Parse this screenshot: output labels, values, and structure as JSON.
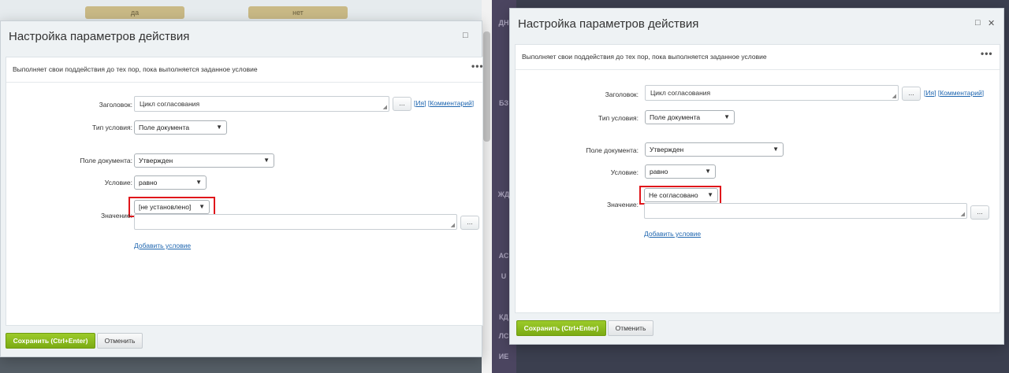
{
  "background": {
    "left_stage_buttons": [
      "да",
      "нет"
    ]
  },
  "sidebar": {
    "items": [
      "ДН",
      "БЗ",
      "ЖД",
      "АС",
      "U",
      "КД",
      "ЛС",
      "ИЕ"
    ]
  },
  "dialogs": [
    {
      "title": "Настройка параметров действия",
      "description": "Выполняет свои поддействия до тех пор, пока выполняется заданное условие",
      "more": "•••",
      "labels": {
        "title_field": "Заголовок:",
        "condition_type": "Тип условия:",
        "document_field": "Поле документа:",
        "condition": "Условие:",
        "value": "Значение:"
      },
      "title_value": "Цикл согласования",
      "dots": "...",
      "link_name": "Ия",
      "link_comment": "Комментарий",
      "condition_type_value": "Поле документа",
      "document_field_value": "Утвержден",
      "condition_value": "равно",
      "value_select": "[не установлено]",
      "value_text": "",
      "add_condition": "Добавить условие",
      "save_label": "Сохранить (Ctrl+Enter)",
      "cancel_label": "Отменить",
      "maximize_icon": "□",
      "close_icon": ""
    },
    {
      "title": "Настройка параметров действия",
      "description": "Выполняет свои поддействия до тех пор, пока выполняется заданное условие",
      "more": "•••",
      "labels": {
        "title_field": "Заголовок:",
        "condition_type": "Тип условия:",
        "document_field": "Поле документа:",
        "condition": "Условие:",
        "value": "Значение:"
      },
      "title_value": "Цикл согласования",
      "dots": "...",
      "link_name": "Ия",
      "link_comment": "Комментарий",
      "condition_type_value": "Поле документа",
      "document_field_value": "Утвержден",
      "condition_value": "равно",
      "value_select": "Не согласовано",
      "value_text": "",
      "add_condition": "Добавить условие",
      "save_label": "Сохранить (Ctrl+Enter)",
      "cancel_label": "Отменить",
      "maximize_icon": "□",
      "close_icon": "✕"
    }
  ],
  "colors": {
    "highlight": "#e0161b",
    "save_button": "#86b51c",
    "link": "#2067b0"
  }
}
